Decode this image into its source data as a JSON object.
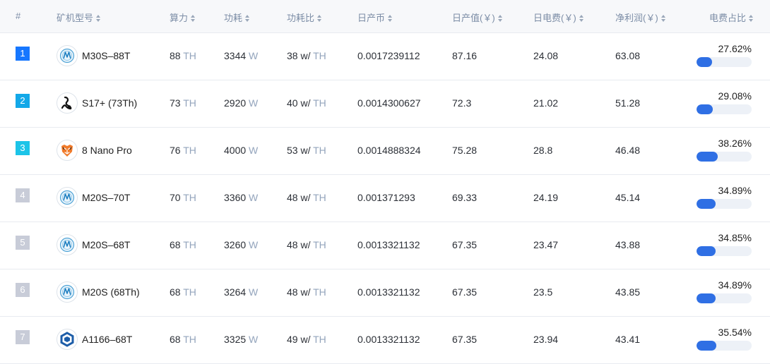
{
  "table": {
    "headers": {
      "rank": "#",
      "model": "矿机型号",
      "hashrate": "算力",
      "power": "功耗",
      "efficiency": "功耗比",
      "daily_coin": "日产币",
      "daily_value": "日产值(￥)",
      "daily_cost": "日电费(￥)",
      "net_profit": "净利润(￥)",
      "cost_ratio": "电费占比"
    },
    "colors": {
      "rank1": "#1677ff",
      "rank2": "#13a8e8",
      "rank3": "#1cc4e8",
      "rank_other": "#c8ccd8",
      "bar_fill": "#2f6fe4",
      "bar_track": "#edf1f7",
      "unit_text": "#93a4bc"
    },
    "units": {
      "hash": "TH",
      "power": "W",
      "eff_prefix": "w/",
      "eff_unit": "TH"
    },
    "rows": [
      {
        "rank": "1",
        "logo": "whatsminer-logo",
        "model": "M30S–88T",
        "hash": "88",
        "power": "3344",
        "eff": "38",
        "coin": "0.0017239112",
        "value": "87.16",
        "cost": "24.08",
        "profit": "63.08",
        "ratio_text": "27.62%",
        "ratio": 0.2762
      },
      {
        "rank": "2",
        "logo": "antminer-logo",
        "model": "S17+ (73Th)",
        "hash": "73",
        "power": "2920",
        "eff": "40",
        "coin": "0.0014300627",
        "value": "72.3",
        "cost": "21.02",
        "profit": "51.28",
        "ratio_text": "29.08%",
        "ratio": 0.2908
      },
      {
        "rank": "3",
        "logo": "ebang-tiger-logo",
        "model": "8 Nano Pro",
        "hash": "76",
        "power": "4000",
        "eff": "53",
        "coin": "0.0014888324",
        "value": "75.28",
        "cost": "28.8",
        "profit": "46.48",
        "ratio_text": "38.26%",
        "ratio": 0.3826
      },
      {
        "rank": "4",
        "logo": "whatsminer-logo",
        "model": "M20S–70T",
        "hash": "70",
        "power": "3360",
        "eff": "48",
        "coin": "0.001371293",
        "value": "69.33",
        "cost": "24.19",
        "profit": "45.14",
        "ratio_text": "34.89%",
        "ratio": 0.3489
      },
      {
        "rank": "5",
        "logo": "whatsminer-logo",
        "model": "M20S–68T",
        "hash": "68",
        "power": "3260",
        "eff": "48",
        "coin": "0.0013321132",
        "value": "67.35",
        "cost": "23.47",
        "profit": "43.88",
        "ratio_text": "34.85%",
        "ratio": 0.3485
      },
      {
        "rank": "6",
        "logo": "whatsminer-logo",
        "model": "M20S (68Th)",
        "hash": "68",
        "power": "3264",
        "eff": "48",
        "coin": "0.0013321132",
        "value": "67.35",
        "cost": "23.5",
        "profit": "43.85",
        "ratio_text": "34.89%",
        "ratio": 0.3489
      },
      {
        "rank": "7",
        "logo": "canaan-logo",
        "model": "A1166–68T",
        "hash": "68",
        "power": "3325",
        "eff": "49",
        "coin": "0.0013321132",
        "value": "67.35",
        "cost": "23.94",
        "profit": "43.41",
        "ratio_text": "35.54%",
        "ratio": 0.3554
      }
    ]
  }
}
